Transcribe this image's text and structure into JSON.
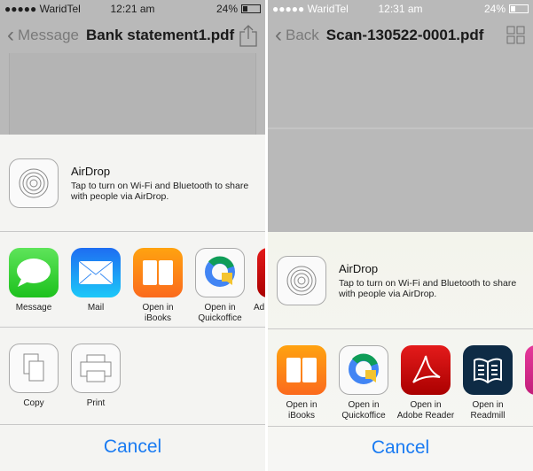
{
  "left": {
    "status": {
      "carrier": "●●●●● WaridTel",
      "time": "12:21 am",
      "battery": "24%",
      "battery_level": 0.24
    },
    "nav": {
      "back": "Message",
      "title": "Bank statement1.pdf",
      "action_icon": "share-icon"
    },
    "airdrop": {
      "title": "AirDrop",
      "desc": "Tap to turn on Wi-Fi and Bluetooth to share with people via AirDrop."
    },
    "apps": [
      {
        "label": "Message",
        "icon": "messages-icon"
      },
      {
        "label": "Mail",
        "icon": "mail-icon"
      },
      {
        "label": "Open in\niBooks",
        "icon": "ibooks-icon"
      },
      {
        "label": "Open in\nQuickoffice",
        "icon": "quickoffice-icon"
      },
      {
        "label": "Ad",
        "icon": "adobe-reader-icon"
      }
    ],
    "actions": [
      {
        "label": "Copy",
        "icon": "copy-icon"
      },
      {
        "label": "Print",
        "icon": "print-icon"
      }
    ],
    "cancel": "Cancel"
  },
  "right": {
    "status": {
      "carrier": "●●●●● WaridTel",
      "time": "12:31 am",
      "battery": "24%",
      "battery_level": 0.24
    },
    "nav": {
      "back": "Back",
      "title": "Scan-130522-0001.pdf",
      "action_icon": "grid-icon"
    },
    "airdrop": {
      "title": "AirDrop",
      "desc": "Tap to turn on Wi-Fi and Bluetooth to share with people via AirDrop."
    },
    "apps": [
      {
        "label": "Open in\niBooks",
        "icon": "ibooks-icon"
      },
      {
        "label": "Open in\nQuickoffice",
        "icon": "quickoffice-icon"
      },
      {
        "label": "Open in\nAdobe Reader",
        "icon": "adobe-reader-icon"
      },
      {
        "label": "Open in\nReadmill",
        "icon": "readmill-icon"
      }
    ],
    "cancel": "Cancel"
  },
  "colors": {
    "accent": "#1a7bf2"
  }
}
